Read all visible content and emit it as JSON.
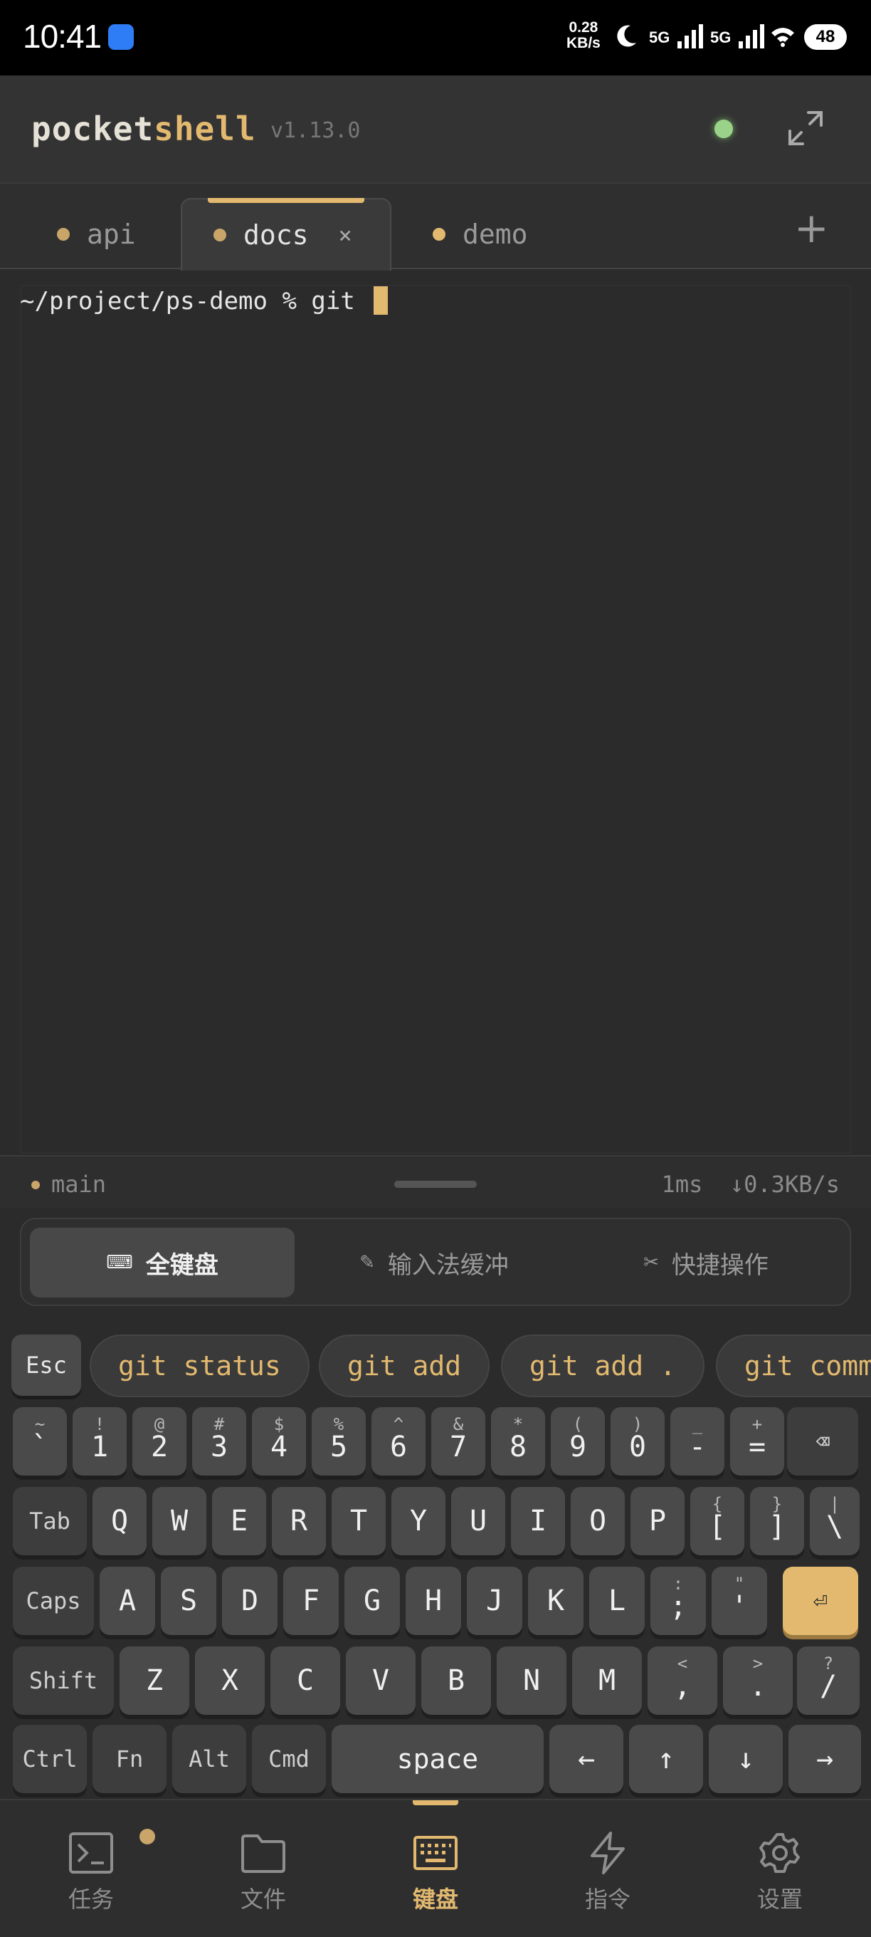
{
  "status_bar": {
    "time": "10:41",
    "net_speed_value": "0.28",
    "net_speed_unit": "KB/s",
    "network_1": "5G",
    "network_2": "5G",
    "battery": "48"
  },
  "header": {
    "brand_prefix": "pocket",
    "brand_suffix": "shell",
    "version": "v1.13.0",
    "connection_status_color": "#9ad28a"
  },
  "tabs": [
    {
      "label": "api",
      "active": false
    },
    {
      "label": "docs",
      "active": true,
      "close": "×"
    },
    {
      "label": "demo",
      "active": false
    }
  ],
  "tab_add": "+",
  "terminal": {
    "prompt": "~/project/ps-demo % git "
  },
  "status_line": {
    "branch": "main",
    "latency": "1ms",
    "download": "↓0.3KB/s"
  },
  "modes": [
    {
      "icon": "keyboard-icon",
      "label": "全键盘",
      "active": true
    },
    {
      "icon": "pencil-icon",
      "label": "输入法缓冲",
      "active": false
    },
    {
      "icon": "scissors-icon",
      "label": "快捷操作",
      "active": false
    }
  ],
  "quick": {
    "esc": "Esc",
    "commands": [
      "git status",
      "git add",
      "git add .",
      "git comm"
    ]
  },
  "keyboard": {
    "row1": [
      {
        "sub": "~",
        "main": "`"
      },
      {
        "sub": "!",
        "main": "1"
      },
      {
        "sub": "@",
        "main": "2"
      },
      {
        "sub": "#",
        "main": "3"
      },
      {
        "sub": "$",
        "main": "4"
      },
      {
        "sub": "%",
        "main": "5"
      },
      {
        "sub": "^",
        "main": "6"
      },
      {
        "sub": "&",
        "main": "7"
      },
      {
        "sub": "*",
        "main": "8"
      },
      {
        "sub": "(",
        "main": "9"
      },
      {
        "sub": ")",
        "main": "0"
      },
      {
        "sub": "_",
        "main": "-"
      },
      {
        "sub": "+",
        "main": "="
      },
      {
        "sub": "",
        "main": "⌫"
      }
    ],
    "row2": [
      {
        "sub": "",
        "main": "Tab"
      },
      {
        "sub": "",
        "main": "Q"
      },
      {
        "sub": "",
        "main": "W"
      },
      {
        "sub": "",
        "main": "E"
      },
      {
        "sub": "",
        "main": "R"
      },
      {
        "sub": "",
        "main": "T"
      },
      {
        "sub": "",
        "main": "Y"
      },
      {
        "sub": "",
        "main": "U"
      },
      {
        "sub": "",
        "main": "I"
      },
      {
        "sub": "",
        "main": "O"
      },
      {
        "sub": "",
        "main": "P"
      },
      {
        "sub": "{",
        "main": "["
      },
      {
        "sub": "}",
        "main": "]"
      },
      {
        "sub": "|",
        "main": "\\"
      }
    ],
    "row3": [
      {
        "sub": "",
        "main": "Caps"
      },
      {
        "sub": "",
        "main": "A"
      },
      {
        "sub": "",
        "main": "S"
      },
      {
        "sub": "",
        "main": "D"
      },
      {
        "sub": "",
        "main": "F"
      },
      {
        "sub": "",
        "main": "G"
      },
      {
        "sub": "",
        "main": "H"
      },
      {
        "sub": "",
        "main": "J"
      },
      {
        "sub": "",
        "main": "K"
      },
      {
        "sub": "",
        "main": "L"
      },
      {
        "sub": ":",
        "main": ";"
      },
      {
        "sub": "\"",
        "main": "'"
      },
      {
        "sub": "",
        "main": "⏎"
      }
    ],
    "row4": [
      {
        "sub": "",
        "main": "Shift"
      },
      {
        "sub": "",
        "main": "Z"
      },
      {
        "sub": "",
        "main": "X"
      },
      {
        "sub": "",
        "main": "C"
      },
      {
        "sub": "",
        "main": "V"
      },
      {
        "sub": "",
        "main": "B"
      },
      {
        "sub": "",
        "main": "N"
      },
      {
        "sub": "",
        "main": "M"
      },
      {
        "sub": "<",
        "main": ","
      },
      {
        "sub": ">",
        "main": "."
      },
      {
        "sub": "?",
        "main": "/"
      }
    ],
    "row5": [
      {
        "sub": "",
        "main": "Ctrl"
      },
      {
        "sub": "",
        "main": "Fn"
      },
      {
        "sub": "",
        "main": "Alt"
      },
      {
        "sub": "",
        "main": "Cmd"
      },
      {
        "sub": "",
        "main": "space"
      },
      {
        "sub": "",
        "main": "←"
      },
      {
        "sub": "",
        "main": "↑"
      },
      {
        "sub": "",
        "main": "↓"
      },
      {
        "sub": "",
        "main": "→"
      }
    ]
  },
  "bottom_nav": [
    {
      "icon": "terminal-icon",
      "label": "任务",
      "active": false,
      "badge": true
    },
    {
      "icon": "folder-icon",
      "label": "文件",
      "active": false
    },
    {
      "icon": "keyboard-icon",
      "label": "键盘",
      "active": true
    },
    {
      "icon": "lightning-icon",
      "label": "指令",
      "active": false
    },
    {
      "icon": "gear-icon",
      "label": "设置",
      "active": false
    }
  ],
  "colors": {
    "accent": "#e2b96f",
    "background": "#2b2b2b",
    "status_online": "#9ad28a"
  }
}
